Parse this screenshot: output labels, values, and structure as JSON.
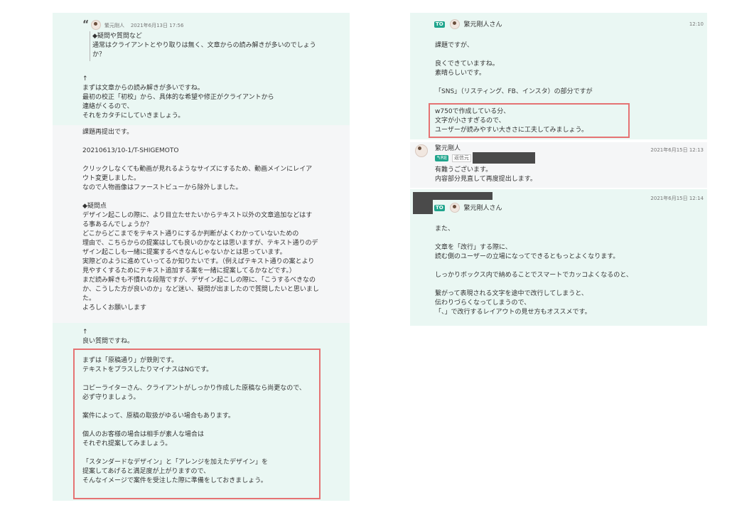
{
  "left": {
    "quote": {
      "author": "繁元剛人",
      "date": "2021年6月13日 17:56",
      "lines": [
        "◆疑問や質問など",
        "通常はクライアントとやり取りは無く、文章からの読み解きが多いのでしょう",
        "か？"
      ]
    },
    "reply1": [
      "↑",
      "まずは文章からの読み解きが多いですね。",
      "最初の校正「初校」から、具体的な希望や修正がクライアントから",
      "連絡がくるので、",
      "それをカタチにしていきましょう。"
    ],
    "student": [
      "課題再提出です。",
      "",
      "20210613/10-1/T-SHIGEMOTO",
      "",
      "クリックしなくても動画が見れるようなサイズにするため、動画メインにレイア",
      "ウト変更しました。",
      "なので人物画像はファーストビューから除外しました。",
      "",
      "◆疑問点",
      "デザイン起こしの際に、より目立たせたいからテキスト以外の文章追加などはす",
      "る事あるんでしょうか？",
      "どこからどこまでをテキスト通りにするか判断がよくわかっていないための",
      "理由で、こちらからの提案はしても良いのかなとは思いますが、テキスト通りのデ",
      "ザイン起こしも一緒に提案するべきなんじゃないかとは思っています。",
      "実際どのように進めていってるか知りたいです。（例えばテキスト通りの案とより",
      "見やすくするためにテキスト追加する案を一緒に提案してるかなどです。）",
      "まだ読み解きも不慣れな段階ですが、デザイン起こしの際に、「こうするべきなの",
      "か、こうした方が良いのか」など迷い、疑問が出ましたので質問したいと思いまし",
      "た。",
      "よろしくお願いします"
    ],
    "reply2_intro": [
      "↑",
      "良い質問ですね。"
    ],
    "reply2_box": [
      "まずは「原稿通り」が鉄則です。",
      "テキストをプラスしたりマイナスはNGです。",
      "",
      "コピーライターさん、クライアントがしっかり作成した原稿なら尚更なので、",
      "必ず守りましょう。",
      "",
      "案件によって、原稿の取扱がゆるい場合もあります。",
      "",
      "個人のお客様の場合は相手が素人な場合は",
      "それぞれ提案してみましょう。",
      "",
      "「スタンダードなデザイン」と「アレンジを加えたデザイン」を",
      "提案してあげると満足度が上がりますので、",
      "そんなイメージで案件を受注した際に準備をしておきましょう。"
    ]
  },
  "right": {
    "msg1": {
      "to_label": "TO",
      "to_name": "繁元剛人さん",
      "time": "12:10",
      "lines": [
        "課題ですが、",
        "",
        "良くできていますね。",
        "素晴らしいです。",
        "",
        "「SNS」（リスティング、FB、インスタ）の部分ですが"
      ],
      "box": [
        "w750で作成している分、",
        "文字が小さすぎるので、",
        "ユーザーが読みやすい大きさに工夫してみましょう。"
      ]
    },
    "msg2": {
      "author": "繁元剛人",
      "date": "2021年6月15日 12:13",
      "re_label": "RE",
      "re_tag": "返信元",
      "lines": [
        "有難うございます。",
        "内容部分見直して再度提出します。"
      ]
    },
    "msg3": {
      "date": "2021年6月15日 12:14",
      "to_label": "TO",
      "to_name": "繁元剛人さん",
      "lines": [
        "また、",
        "",
        "文章を「改行」する際に、",
        "読む側のユーザーの立場になってできるともっとよくなります。",
        "",
        "しっかりボックス内で納めることでスマートでカッコよくなるのと、",
        "",
        "繋がって表現される文字を途中で改行してしまうと、",
        "伝わりづらくなってしまうので、",
        "「、」で改行するレイアウトの見せ方もオススメです。"
      ]
    }
  }
}
